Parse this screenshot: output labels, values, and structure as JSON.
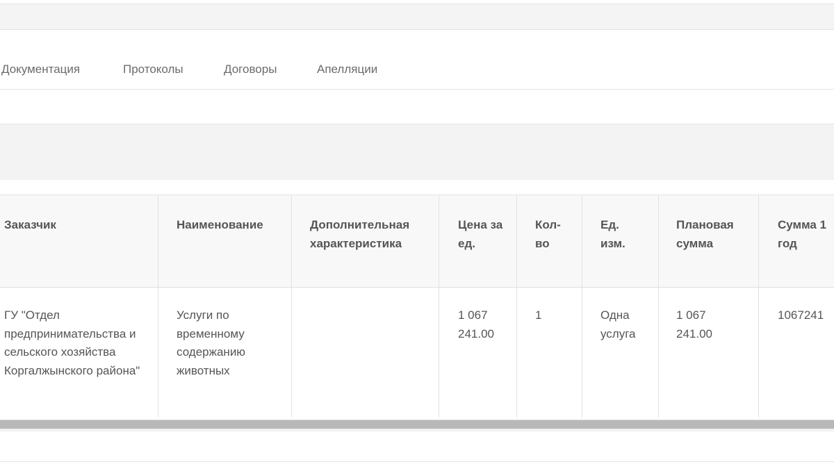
{
  "tabs": [
    {
      "label": "Документация"
    },
    {
      "label": "Протоколы"
    },
    {
      "label": "Договоры"
    },
    {
      "label": "Апелляции"
    }
  ],
  "table": {
    "columns": [
      "Заказчик",
      "Наименование",
      "Дополнительная характеристика",
      "Цена за ед.",
      "Кол-во",
      "Ед. изм.",
      "Плановая сумма",
      "Сумма 1 год"
    ],
    "rows": [
      {
        "customer": "ГУ \"Отдел предпринимательства и сельского хозяйства Коргалжынского района\"",
        "name": "Услуги по временному содержанию животных",
        "extra": "",
        "unit_price": "1 067 241.00",
        "qty": "1",
        "unit": "Одна услуга",
        "planned_sum": "1 067 241.00",
        "sum_year1": "1067241"
      }
    ]
  }
}
